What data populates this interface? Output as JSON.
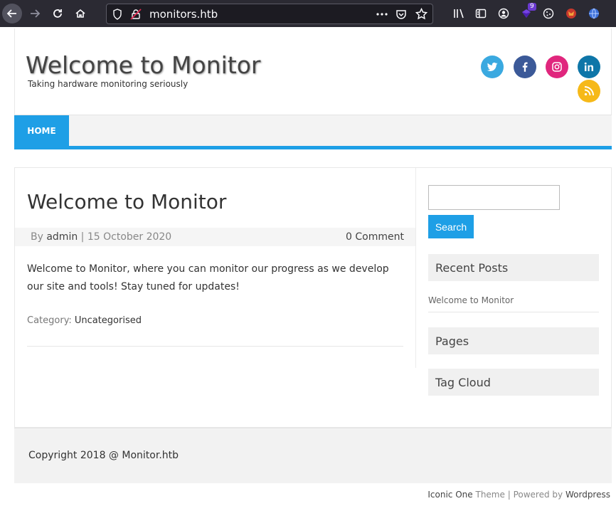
{
  "browser": {
    "url": "monitors.htb",
    "extension_badge": "9",
    "icons": [
      "back-icon",
      "forward-icon",
      "reload-icon",
      "home-icon",
      "shield-icon",
      "insecure-lock-icon",
      "more-icon",
      "pocket-icon",
      "star-icon",
      "library-icon",
      "sidebar-icon",
      "account-icon",
      "extension-icon",
      "cookie-icon",
      "extension-fox-icon",
      "globe-icon"
    ]
  },
  "site": {
    "title": "Welcome to Monitor",
    "tagline": "Taking hardware monitoring seriously",
    "accent": "#1e9fe6"
  },
  "social": [
    {
      "name": "twitter",
      "color": "#3aa9e0"
    },
    {
      "name": "facebook",
      "color": "#3b5998"
    },
    {
      "name": "instagram",
      "color": "#e0267d"
    },
    {
      "name": "linkedin",
      "color": "#0e76a8"
    },
    {
      "name": "rss",
      "color": "#f6b919"
    }
  ],
  "nav": {
    "home": "HOME"
  },
  "post": {
    "title": "Welcome to Monitor",
    "by": "By",
    "author": "admin",
    "separator": "|",
    "date": "15 October 2020",
    "comments": "0 Comment",
    "body": "Welcome to Monitor, where you can monitor our progress as we develop our site and tools! Stay tuned for updates!",
    "category_label": "Category:",
    "category": "Uncategorised"
  },
  "sidebar": {
    "search_button": "Search",
    "search_placeholder": "",
    "recent_posts_title": "Recent Posts",
    "recent_posts": [
      "Welcome to Monitor"
    ],
    "pages_title": "Pages",
    "tag_cloud_title": "Tag Cloud"
  },
  "footer": {
    "copyright": "Copyright 2018 @ Monitor.htb",
    "theme_name": "Iconic One",
    "theme_word": "Theme",
    "sep": "|",
    "powered_by": "Powered by",
    "wordpress": "Wordpress"
  }
}
